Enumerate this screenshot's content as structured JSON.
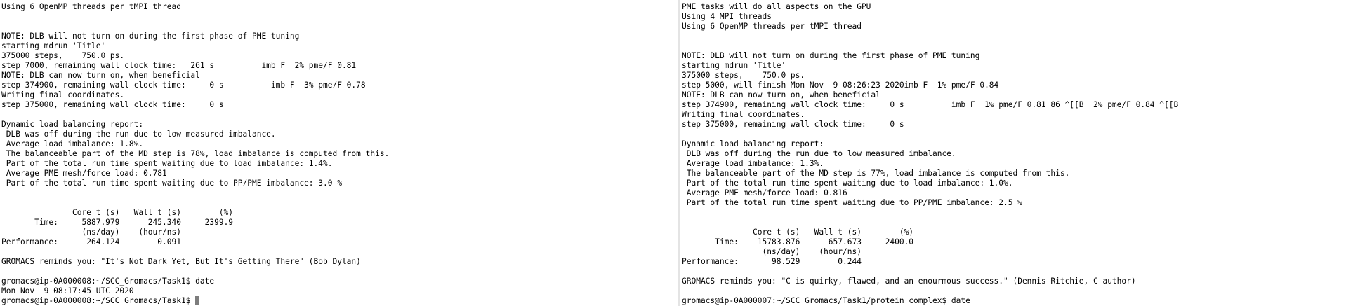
{
  "left_terminal": {
    "lines": [
      "Using 6 OpenMP threads per tMPI thread",
      "",
      "",
      "NOTE: DLB will not turn on during the first phase of PME tuning",
      "starting mdrun 'Title'",
      "375000 steps,    750.0 ps.",
      "step 7000, remaining wall clock time:   261 s          imb F  2% pme/F 0.81",
      "NOTE: DLB can now turn on, when beneficial",
      "step 374900, remaining wall clock time:     0 s          imb F  3% pme/F 0.78",
      "Writing final coordinates.",
      "step 375000, remaining wall clock time:     0 s",
      "",
      "Dynamic load balancing report:",
      " DLB was off during the run due to low measured imbalance.",
      " Average load imbalance: 1.8%.",
      " The balanceable part of the MD step is 78%, load imbalance is computed from this.",
      " Part of the total run time spent waiting due to load imbalance: 1.4%.",
      " Average PME mesh/force load: 0.781",
      " Part of the total run time spent waiting due to PP/PME imbalance: 3.0 %",
      "",
      "",
      "               Core t (s)   Wall t (s)        (%)",
      "       Time:     5887.979      245.340     2399.9",
      "                 (ns/day)    (hour/ns)",
      "Performance:      264.124        0.091",
      "",
      "GROMACS reminds you: \"It's Not Dark Yet, But It's Getting There\" (Bob Dylan)",
      "",
      "gromacs@ip-0A000008:~/SCC_Gromacs/Task1$ date",
      "Mon Nov  9 08:17:45 UTC 2020"
    ],
    "prompt": "gromacs@ip-0A000008:~/SCC_Gromacs/Task1$ "
  },
  "right_terminal": {
    "lines": [
      "PME tasks will do all aspects on the GPU",
      "Using 4 MPI threads",
      "Using 6 OpenMP threads per tMPI thread",
      "",
      "",
      "NOTE: DLB will not turn on during the first phase of PME tuning",
      "starting mdrun 'Title'",
      "375000 steps,    750.0 ps.",
      "step 5000, will finish Mon Nov  9 08:26:23 2020imb F  1% pme/F 0.84",
      "NOTE: DLB can now turn on, when beneficial",
      "step 374900, remaining wall clock time:     0 s          imb F  1% pme/F 0.81 86 ^[[B  2% pme/F 0.84 ^[[B",
      "Writing final coordinates.",
      "step 375000, remaining wall clock time:     0 s",
      "",
      "Dynamic load balancing report:",
      " DLB was off during the run due to low measured imbalance.",
      " Average load imbalance: 1.3%.",
      " The balanceable part of the MD step is 77%, load imbalance is computed from this.",
      " Part of the total run time spent waiting due to load imbalance: 1.0%.",
      " Average PME mesh/force load: 0.816",
      " Part of the total run time spent waiting due to PP/PME imbalance: 2.5 %",
      "",
      "",
      "               Core t (s)   Wall t (s)        (%)",
      "       Time:    15783.876      657.673     2400.0",
      "                 (ns/day)    (hour/ns)",
      "Performance:       98.529        0.244",
      "",
      "GROMACS reminds you: \"C is quirky, flawed, and an enourmous success.\" (Dennis Ritchie, C author)",
      "",
      "gromacs@ip-0A000007:~/SCC_Gromacs/Task1/protein_complex$ date"
    ]
  }
}
